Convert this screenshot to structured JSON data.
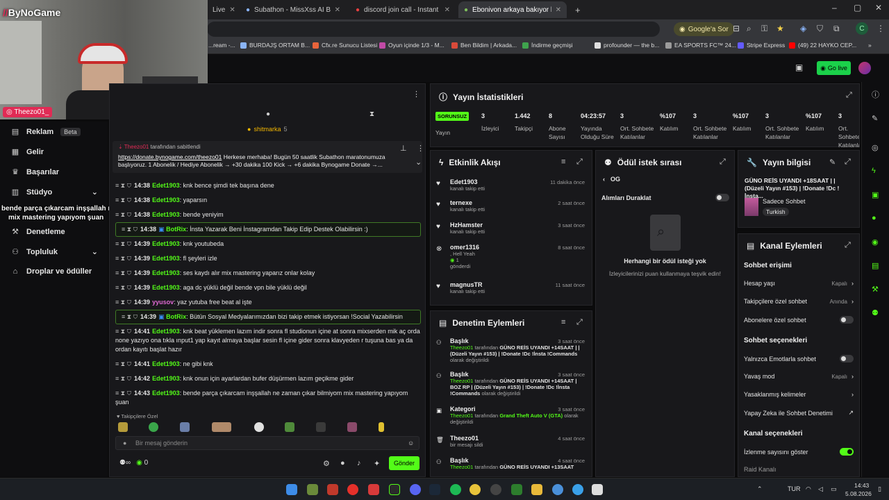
{
  "browser": {
    "tabs": [
      {
        "title": "Live"
      },
      {
        "title": "Subathon - MissXss AI Bot Syst..."
      },
      {
        "title": "discord join call - Instant Soun..."
      },
      {
        "title": "Ebonivon arkaya bakıyor birand..."
      }
    ],
    "new_tab": "+",
    "google_chip": "Google'a Sor",
    "profile_letter": "C",
    "bookmarks": [
      "...ream -...",
      "BURDAJŞ ORTAM B...",
      "Cfx.re Sunucu Listesi",
      "Oyun içinde 1/3 - M...",
      "Ben Bildim | Arkada...",
      "İndirme geçmişi",
      "profounder — the b...",
      "EA SPORTS FC™ 24...",
      "Stripe Express",
      "(49) 22 HAYKO CEP..."
    ]
  },
  "webcam": {
    "logo": "ByNoGame",
    "name_tag": "Theezo01_"
  },
  "header": {
    "go_live": "Go live"
  },
  "sidebar": {
    "items": [
      {
        "label": "Reklam",
        "badge": "Beta"
      },
      {
        "label": "Gelir"
      },
      {
        "label": "Başarılar"
      },
      {
        "label": "Stüdyo"
      },
      {
        "label": "Denetleme"
      },
      {
        "label": "Topluluk"
      },
      {
        "label": "Droplar ve ödüller"
      }
    ],
    "overlay_lines": [
      "bende parça çıkarcam inşşallah ne zaman çıkar bilmiyom",
      "mix mastering yapıyom şuan"
    ]
  },
  "chat": {
    "gift_user": "shitmarka",
    "gift_count": "5",
    "pinned_by": "Theezo01",
    "pinned_suffix": "tarafından sabitlendi",
    "pinned_link": "https://donate.bynogame.com/theezo01",
    "pinned_text": " Herkese merhaba! Bugün 50 saatlik Subathon maratonumuza başlıyoruz. 1 Abonelik / Hediye Abonelik → +30 dakika 100 Kick → +6 dakika Bynogame Donate →...",
    "messages": [
      {
        "time": "14:38",
        "user": "Edet1903",
        "text": "knk bence şimdi tek başına dene"
      },
      {
        "time": "14:38",
        "user": "Edet1903",
        "text": "yaparsın"
      },
      {
        "time": "14:38",
        "user": "Edet1903",
        "text": "bende yeniyim"
      },
      {
        "time": "14:38",
        "user": "BotRix",
        "text": "İnsta Yazarak Beni İnstagramdan Takip Edip Destek Olabilirsin :)"
      },
      {
        "time": "14:39",
        "user": "Edet1903",
        "text": "knk youtubeda"
      },
      {
        "time": "14:39",
        "user": "Edet1903",
        "text": "fl şeyleri izle"
      },
      {
        "time": "14:39",
        "user": "Edet1903",
        "text": "ses kaydı alır mix mastering yaparız onlar kolay"
      },
      {
        "time": "14:39",
        "user": "Edet1903",
        "text": "aga dc yüklü değil bende vpn bile yüklü değil"
      },
      {
        "time": "14:39",
        "user": "yyusov",
        "text": "yaz yutuba free beat al işte"
      },
      {
        "time": "14:39",
        "user": "BotRix",
        "text": "Bütün Sosyal Medyalarımızdan bizi takip etmek istiyorsan !Social Yazabilirsin"
      },
      {
        "time": "14:41",
        "user": "Edet1903",
        "text": "knk beat yüklemen lazım indir sonra fl studionun içine at sonra mixserden mik aç orda none yazıyo ona tıkla ınput1 yap kayıt almaya başlar sesin fl içine gider sonra klavyeden r tuşuna bas ya da ordan kayıtı başlat hazır"
      },
      {
        "time": "14:41",
        "user": "Edet1903",
        "text": "ne gibi knk"
      },
      {
        "time": "14:42",
        "user": "Edet1903",
        "text": "knk onun için ayarlardan bufer düşürmen lazım geçikme gider"
      },
      {
        "time": "14:43",
        "user": "Edet1903",
        "text": "bende parça çıkarcam inşşallah ne zaman çıkar bilmiyom mix mastering yapıyom şuan"
      }
    ],
    "emote_section": "Takipçilere Özel",
    "input_placeholder": "Bir mesaj gönderin",
    "points": "∞",
    "count": "0",
    "send": "Gönder"
  },
  "stats": {
    "title": "Yayın İstatistikleri",
    "items": [
      {
        "value": "SORUNSUZ",
        "label": "Yayın"
      },
      {
        "value": "3",
        "label": "İzleyici"
      },
      {
        "value": "1.442",
        "label": "Takipçi"
      },
      {
        "value": "8",
        "label": "Abone Sayısı"
      },
      {
        "value": "04:23:57",
        "label": "Yayında Olduğu Süre"
      },
      {
        "value": "3",
        "label": "Ort. Sohbete Katılanlar"
      },
      {
        "value": "%107",
        "label": "Katılım"
      },
      {
        "value": "3",
        "label": "Ort. Sohbete Katılanlar"
      },
      {
        "value": "%107",
        "label": "Katılım"
      },
      {
        "value": "3",
        "label": "Ort. Sohbete Katılanlar"
      },
      {
        "value": "%107",
        "label": "Katılım"
      },
      {
        "value": "3",
        "label": "Ort. Sohbete Katılanlar"
      }
    ]
  },
  "activity": {
    "title": "Etkinlik Akışı",
    "events": [
      {
        "user": "Edet1903",
        "sub": "kanalı takip etti",
        "time": "11 dakika önce"
      },
      {
        "user": "ternexe",
        "sub": "kanalı takip etti",
        "time": "2 saat önce"
      },
      {
        "user": "HzHamster",
        "sub": "kanalı takip etti",
        "time": "3 saat önce"
      },
      {
        "user": "omer1316",
        "sub": "gönderdi",
        "extra": ", Hell Yeah",
        "amount": "1",
        "time": "8 saat önce"
      },
      {
        "user": "magnusTR",
        "sub": "kanalı takip etti",
        "time": "11 saat önce"
      }
    ]
  },
  "rewards": {
    "title": "Ödül istek sırası",
    "back": "OG",
    "pause_label": "Alımları Duraklat",
    "empty_title": "Herhangi bir ödül isteği yok",
    "empty_sub": "İzleyicilerinizi puan kullanmaya teşvik edin!"
  },
  "info": {
    "title": "Yayın bilgisi",
    "stream_title": "GÜNO REİS UYANDI +18SAAT | | (Düzeli Yayın #153) | !Donate !Dc !İnsta...",
    "category": "Sadece Sohbet",
    "language": "Turkish"
  },
  "moderation": {
    "title": "Denetim Eylemleri",
    "items": [
      {
        "type": "Başlık",
        "time": "3 saat önce",
        "by": "Theezo01",
        "mid": "tarafından",
        "value": "GÜNO REİS UYANDI +14SAAT | | (Düzeli Yayın #153) | !Donate !Dc !İnsta !Commands",
        "suffix": "olarak değiştirildi"
      },
      {
        "type": "Başlık",
        "time": "3 saat önce",
        "by": "Theezo01",
        "mid": "tarafından",
        "value": "GÜNO REİS UYANDI +14SAAT | BOZ RP | (Düzeli Yayın #153) | !Donate !Dc !İnsta !Commands",
        "suffix": "olarak değiştirildi"
      },
      {
        "type": "Kategori",
        "time": "3 saat önce",
        "by": "Theezo01",
        "mid": "tarafından",
        "value": "Grand Theft Auto V (GTA)",
        "suffix": "olarak değiştirildi"
      },
      {
        "type": "Theezo01",
        "time": "4 saat önce",
        "by": "",
        "mid": "",
        "value": "",
        "suffix": "bir mesajı sildi"
      },
      {
        "type": "Başlık",
        "time": "4 saat önce",
        "by": "Theezo01",
        "mid": "tarafından",
        "value": "GÜNO REİS UYANDI +13SAAT",
        "suffix": ""
      }
    ]
  },
  "channel": {
    "title": "Kanal Eylemleri",
    "chat_access": "Sohbet erişimi",
    "account_age": "Hesap yaşı",
    "account_age_v": "Kapalı",
    "followers_only": "Takipçilere özel sohbet",
    "followers_only_v": "Anında",
    "subs_only": "Abonelere özel sohbet",
    "chat_options": "Sohbet seçenekleri",
    "emote_only": "Yalnızca Emotlarla sohbet",
    "slow_mode": "Yavaş mod",
    "slow_mode_v": "Kapalı",
    "banned_words": "Yasaklanmış kelimeler",
    "ai_mod": "Yapay Zeka ile Sohbet Denetimi",
    "channel_options": "Kanal seçenekleri",
    "show_views": "İzlenme sayısını göster",
    "raid": "Raid Kanalı",
    "badge": "16"
  },
  "taskbar": {
    "lang": "TUR",
    "time": "14:43",
    "date": "5.08.2026"
  },
  "colors": {
    "accent": "#53fc18",
    "bg": "#0b0b0c",
    "panel": "#18181b"
  }
}
